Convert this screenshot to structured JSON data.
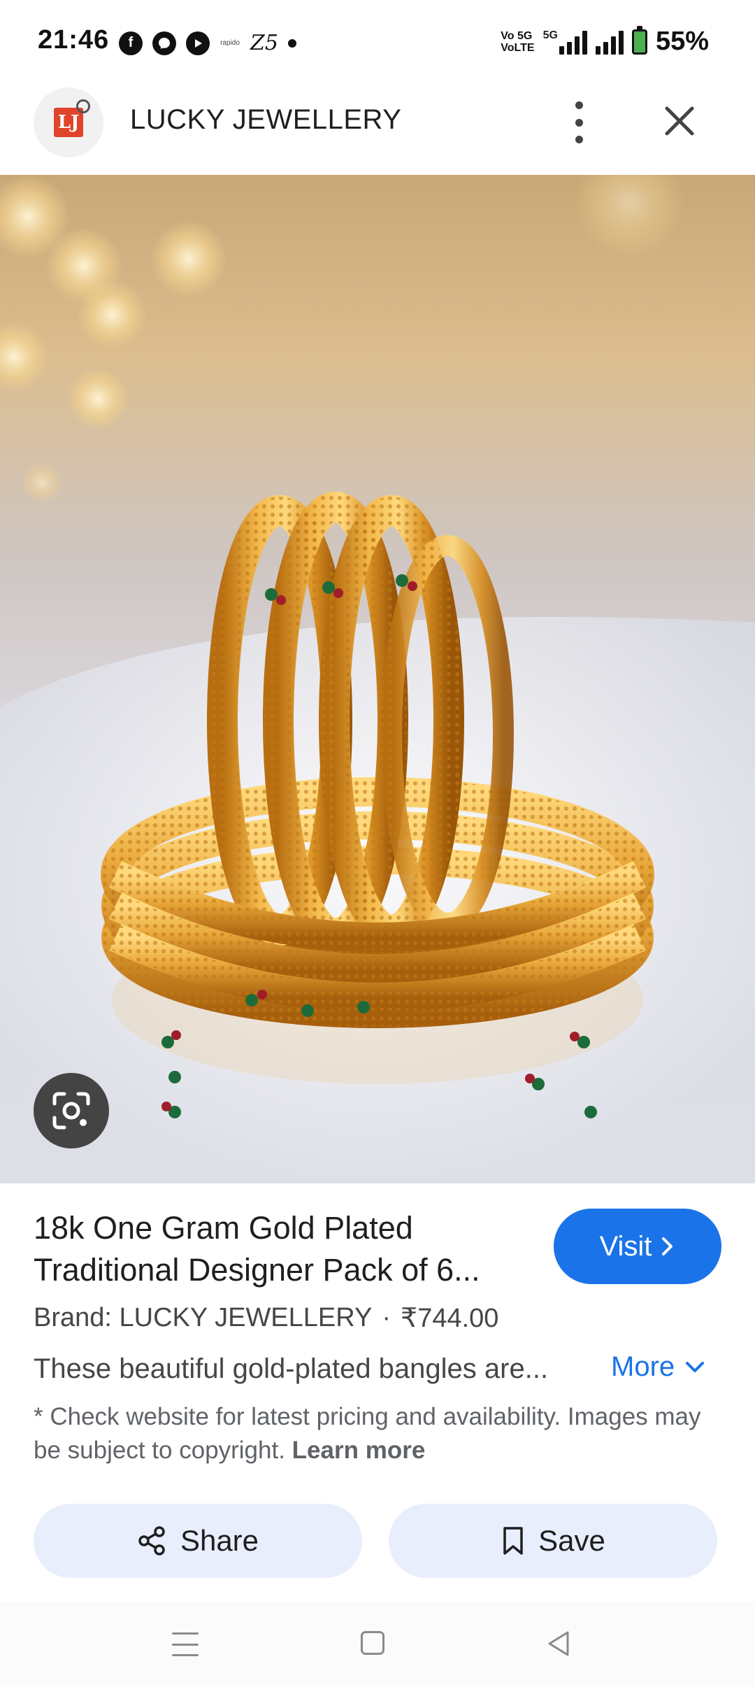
{
  "status_bar": {
    "time": "21:46",
    "app_icons": [
      "facebook-icon",
      "messenger-icon",
      "youtube-icon",
      "rapido-icon",
      "z5-icon",
      "dot-icon"
    ],
    "rapido_label": "rapido",
    "z5_label": "Z5",
    "network_volte": "Vo 5G\nVoLTE",
    "network_5g": "5G",
    "battery_percent": "55%"
  },
  "header": {
    "site_name": "LUCKY JEWELLERY",
    "logo_text": "LJ"
  },
  "product": {
    "title": "18k One Gram Gold Plated Traditional Designer Pack of 6...",
    "visit_label": "Visit",
    "brand_label": "Brand: LUCKY JEWELLERY",
    "separator": "·",
    "price": "₹744.00",
    "description": "These beautiful gold-plated bangles are...",
    "more_label": "More",
    "disclaimer": "* Check website for latest pricing and availability. Images may be subject to copyright.",
    "learn_more_label": "Learn more"
  },
  "actions": {
    "share_label": "Share",
    "save_label": "Save"
  },
  "colors": {
    "accent": "#1a73e8",
    "action_bg": "#e8eefb",
    "gold": "#d4952a"
  }
}
